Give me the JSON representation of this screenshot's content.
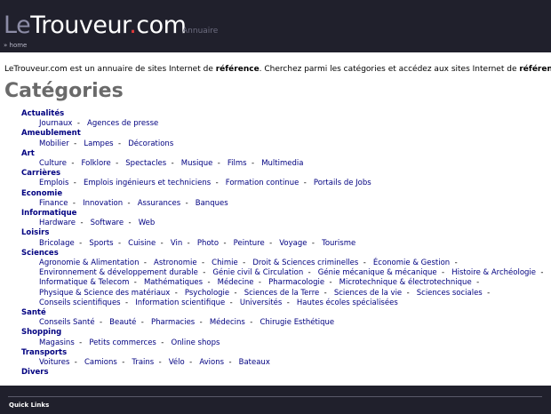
{
  "header": {
    "logo_le": "Le",
    "logo_trouveur": "Trouveur",
    "logo_dot": ".",
    "logo_com": "com",
    "logo_sub": "Annuaire",
    "breadcrumb_prefix": "» ",
    "breadcrumb_home": "home"
  },
  "intro": {
    "part1": "LeTrouveur.com est un annuaire de sites Internet de ",
    "bold1": "référence",
    "part2": ". Cherchez parmi les catégories et accédez aux sites Internet de ",
    "bold2": "référence",
    "part3": "."
  },
  "page_title": "Catégories",
  "categories": [
    {
      "name": "Actualités",
      "subs": [
        "Journaux",
        "Agences de presse"
      ]
    },
    {
      "name": "Ameublement",
      "subs": [
        "Mobilier",
        "Lampes",
        "Décorations"
      ]
    },
    {
      "name": "Art",
      "subs": [
        "Culture",
        "Folklore",
        "Spectacles",
        "Musique",
        "Films",
        "Multimedia"
      ]
    },
    {
      "name": "Carrières",
      "subs": [
        "Emplois",
        "Emplois ingénieurs et techniciens",
        "Formation continue",
        "Portails de Jobs"
      ]
    },
    {
      "name": "Economie",
      "subs": [
        "Finance",
        "Innovation",
        "Assurances",
        "Banques"
      ]
    },
    {
      "name": "Informatique",
      "subs": [
        "Hardware",
        "Software",
        "Web"
      ]
    },
    {
      "name": "Loisirs",
      "subs": [
        "Bricolage",
        "Sports",
        "Cuisine",
        "Vin",
        "Photo",
        "Peinture",
        "Voyage",
        "Tourisme"
      ]
    },
    {
      "name": "Sciences",
      "subs": [
        "Agronomie & Alimentation",
        "Astronomie",
        "Chimie",
        "Droit & Sciences criminelles",
        "Économie & Gestion",
        "Environnement & développement durable",
        "Génie civil & Circulation",
        "Génie mécanique & mécanique",
        "Histoire & Archéologie",
        "Informatique & Telecom",
        "Mathématiques",
        "Médecine",
        "Pharmacologie",
        "Microtechnique & électrotechnique",
        "Physique & Science des matériaux",
        "Psychologie",
        "Sciences de la Terre",
        "Sciences de la vie",
        "Sciences sociales",
        "Conseils scientifiques",
        "Information scientifique",
        "Universités",
        "Hautes écoles spécialisées"
      ]
    },
    {
      "name": "Santé",
      "subs": [
        "Conseils Santé",
        "Beauté",
        "Pharmacies",
        "Médecins",
        "Chirugie Esthétique"
      ]
    },
    {
      "name": "Shopping",
      "subs": [
        "Magasins",
        "Petits commerces",
        "Online shops"
      ]
    },
    {
      "name": "Transports",
      "subs": [
        "Voitures",
        "Camions",
        "Trains",
        "Vélo",
        "Avions",
        "Bateaux"
      ]
    },
    {
      "name": "Divers",
      "subs": []
    }
  ],
  "footer": {
    "quick_links": "Quick Links"
  }
}
